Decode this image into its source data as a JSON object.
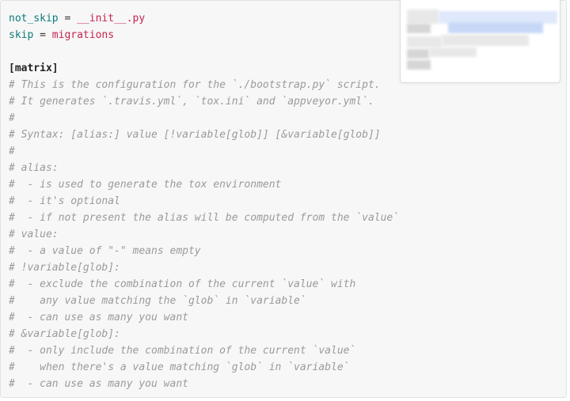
{
  "code": {
    "lines": [
      {
        "kind": "assign",
        "key": "not_skip",
        "op": " = ",
        "value": "__init__.py"
      },
      {
        "kind": "assign",
        "key": "skip",
        "op": " = ",
        "value": "migrations"
      },
      {
        "kind": "blank",
        "text": ""
      },
      {
        "kind": "section",
        "text": "[matrix]"
      },
      {
        "kind": "comment",
        "text": "# This is the configuration for the `./bootstrap.py` script."
      },
      {
        "kind": "comment",
        "text": "# It generates `.travis.yml`, `tox.ini` and `appveyor.yml`."
      },
      {
        "kind": "comment",
        "text": "#"
      },
      {
        "kind": "comment",
        "text": "# Syntax: [alias:] value [!variable[glob]] [&variable[glob]]"
      },
      {
        "kind": "comment",
        "text": "#"
      },
      {
        "kind": "comment",
        "text": "# alias:"
      },
      {
        "kind": "comment",
        "text": "#  - is used to generate the tox environment"
      },
      {
        "kind": "comment",
        "text": "#  - it's optional"
      },
      {
        "kind": "comment",
        "text": "#  - if not present the alias will be computed from the `value`"
      },
      {
        "kind": "comment",
        "text": "# value:"
      },
      {
        "kind": "comment",
        "text": "#  - a value of \"-\" means empty"
      },
      {
        "kind": "comment",
        "text": "# !variable[glob]:"
      },
      {
        "kind": "comment",
        "text": "#  - exclude the combination of the current `value` with"
      },
      {
        "kind": "comment",
        "text": "#    any value matching the `glob` in `variable`"
      },
      {
        "kind": "comment",
        "text": "#  - can use as many you want"
      },
      {
        "kind": "comment",
        "text": "# &variable[glob]:"
      },
      {
        "kind": "comment",
        "text": "#  - only include the combination of the current `value`"
      },
      {
        "kind": "comment",
        "text": "#    when there's a value matching `glob` in `variable`"
      },
      {
        "kind": "comment",
        "text": "#  - can use as many you want"
      }
    ]
  },
  "popup": {
    "content": "obscured",
    "colors": {
      "blue_light": "#dfe9fb",
      "blue_mid": "#c7d8f6",
      "gray_light": "#e8e8e8",
      "gray_mid": "#d6d6d6"
    }
  }
}
